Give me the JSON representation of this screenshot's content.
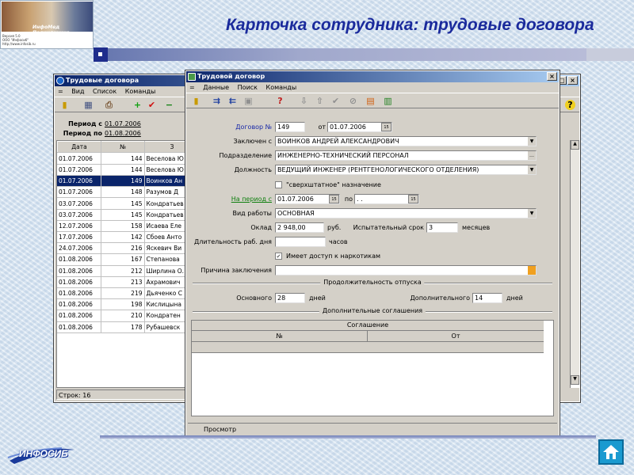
{
  "slide": {
    "title": "Карточка сотрудника: трудовые договора",
    "logo_brand": "ИнфоМед Поликлиника",
    "logo_lines": [
      "Версия 5.0",
      "ООО \"Инфосиб\"",
      "http://www.infosib.ru"
    ],
    "footer_logo": "ИНФОСИБ",
    "nav_button_icon": "home-icon"
  },
  "back_window": {
    "title": "Трудовые договора",
    "menu": [
      "=",
      "Вид",
      "Список",
      "Команды"
    ],
    "period_from_label": "Период с",
    "period_from": "01.07.2006",
    "period_to_label": "Период по",
    "period_to": "01.08.2006",
    "columns": [
      "Дата",
      "№",
      "З"
    ],
    "rows": [
      {
        "date": "01.07.2006",
        "num": "144",
        "name": "Веселова Ю"
      },
      {
        "date": "01.07.2006",
        "num": "144",
        "name": "Веселова Ю"
      },
      {
        "date": "01.07.2006",
        "num": "149",
        "name": "Воинков Ан"
      },
      {
        "date": "01.07.2006",
        "num": "148",
        "name": "Разумов Д"
      },
      {
        "date": "03.07.2006",
        "num": "145",
        "name": "Кондратьев"
      },
      {
        "date": "03.07.2006",
        "num": "145",
        "name": "Кондратьев"
      },
      {
        "date": "12.07.2006",
        "num": "158",
        "name": "Исаева Еле"
      },
      {
        "date": "17.07.2006",
        "num": "142",
        "name": "Сбоев Анто"
      },
      {
        "date": "24.07.2006",
        "num": "216",
        "name": "Яскевич Ви"
      },
      {
        "date": "01.08.2006",
        "num": "167",
        "name": "Степанова"
      },
      {
        "date": "01.08.2006",
        "num": "212",
        "name": "Ширлина О."
      },
      {
        "date": "01.08.2006",
        "num": "213",
        "name": "Ахрамович"
      },
      {
        "date": "01.08.2006",
        "num": "219",
        "name": "Дьяченко С"
      },
      {
        "date": "01.08.2006",
        "num": "198",
        "name": "Кислицына"
      },
      {
        "date": "01.08.2006",
        "num": "210",
        "name": "Кондратен"
      },
      {
        "date": "01.08.2006",
        "num": "178",
        "name": "Рубашевск"
      }
    ],
    "selected_row": 2,
    "status": "Строк: 16"
  },
  "front_window": {
    "title": "Трудовой договор",
    "menu": [
      "=",
      "Данные",
      "Поиск",
      "Команды"
    ],
    "contract_label": "Договор №",
    "contract_no": "149",
    "from_label": "от",
    "contract_date": "01.07.2006",
    "concluded_label": "Заключен с",
    "employee": "ВОИНКОВ АНДРЕЙ АЛЕКСАНДРОВИЧ",
    "dept_label": "Подразделение",
    "department": "ИНЖЕНЕРНО-ТЕХНИЧЕСКИЙ ПЕРСОНАЛ",
    "position_label": "Должность",
    "position": "ВЕДУЩИЙ ИНЖЕНЕР (РЕНТГЕНОЛОГИЧЕСКОГО ОТДЕЛЕНИЯ)",
    "extra_staff_label": "\"сверхштатное\" назначение",
    "period_label": "На период с",
    "period_from": "01.07.2006",
    "period_to_label": "по",
    "period_to": ". .",
    "work_type_label": "Вид работы",
    "work_type": "ОСНОВНАЯ",
    "salary_label": "Оклад",
    "salary": "2 948,00",
    "salary_unit": "руб.",
    "probation_label": "Испытательный срок",
    "probation": "3",
    "probation_unit": "месяцев",
    "day_length_label": "Длительность раб. дня",
    "day_length": "",
    "day_length_unit": "часов",
    "narcotics_label": "Имеет доступ к наркотикам",
    "narcotics_checked": true,
    "reason_label": "Причина заключения",
    "reason": "",
    "vacation_group": "Продолжительность отпуска",
    "main_vac_label": "Основного",
    "main_vac": "28",
    "main_vac_unit": "дней",
    "add_vac_label": "Дополнительного",
    "add_vac": "14",
    "add_vac_unit": "дней",
    "agreements_group": "Дополнительные соглашения",
    "agreement_header": "Соглашение",
    "agreement_cols": [
      "№",
      "От"
    ],
    "status_tab": "Просмотр"
  }
}
